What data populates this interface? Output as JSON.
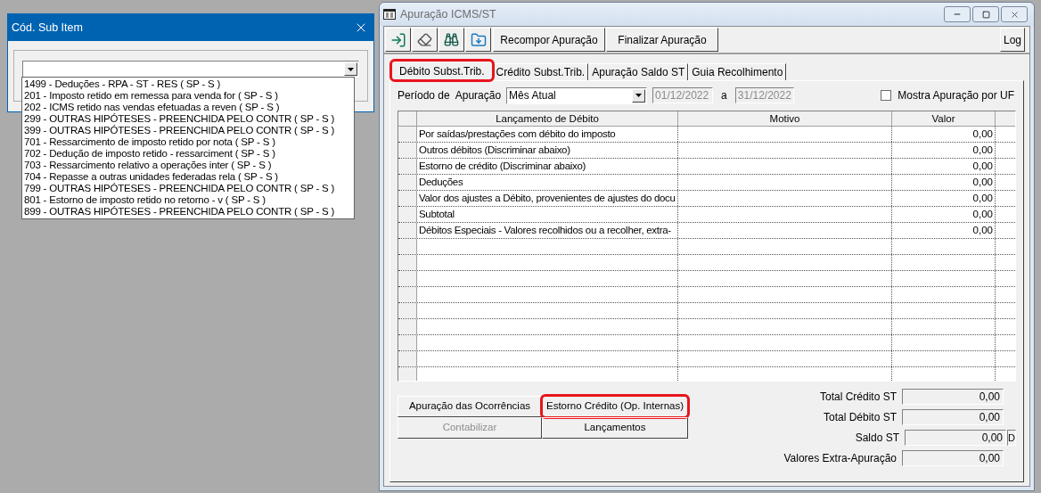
{
  "sub_item_dialog": {
    "title": "Cód. Sub Item",
    "combo": {
      "open": true
    },
    "options": [
      {
        "label": "1499 - Deduções - RPA - ST - RES ( SP - S )"
      },
      {
        "label": "201 - Imposto retido em remessa para venda for ( SP - S )"
      },
      {
        "label": "202 - ICMS retido nas vendas efetuadas a reven ( SP - S )"
      },
      {
        "label": "299 - OUTRAS HIPÓTESES - PREENCHIDA PELO CONTR ( SP - S )"
      },
      {
        "label": "399 - OUTRAS HIPÓTESES - PREENCHIDA PELO CONTR ( SP - S )"
      },
      {
        "label": "701 - Ressarcimento de imposto retido por nota ( SP - S )"
      },
      {
        "label": "702 - Dedução de imposto retido - ressarciment ( SP - S )"
      },
      {
        "label": "703 - Ressarcimento relativo a operações inter ( SP - S )"
      },
      {
        "label": "704 - Repasse a outras unidades federadas rela ( SP - S )"
      },
      {
        "label": "799 - OUTRAS HIPÓTESES - PREENCHIDA PELO CONTR ( SP - S )"
      },
      {
        "label": "801 - Estorno de imposto retido no retorno - v ( SP - S )"
      },
      {
        "label": "899 - OUTRAS HIPÓTESES - PREENCHIDA PELO CONTR ( SP - S )"
      }
    ]
  },
  "main_window": {
    "title": "Apuração ICMS/ST",
    "toolbar": {
      "buttons": [
        "Recompor Apuração",
        "Finalizar Apuração"
      ],
      "log": "Log"
    },
    "tabs": [
      {
        "label": "Débito Subst.Trib.",
        "selected": true,
        "highlighted": true
      },
      {
        "label": "Crédito Subst.Trib.",
        "selected": false,
        "highlighted": false
      },
      {
        "label": "Apuração Saldo ST",
        "selected": false,
        "highlighted": false
      },
      {
        "label": "Guia Recolhimento",
        "selected": false,
        "highlighted": false
      }
    ],
    "period": {
      "label": "Período de  Apuração",
      "value": "Mês Atual",
      "from": "01/12/2022",
      "separator": "a",
      "to": "31/12/2022",
      "by_uf": {
        "label": "Mostra Apuração por UF",
        "checked": false
      }
    },
    "table": {
      "columns": [
        "Lançamento de Débito",
        "Motivo",
        "Valor"
      ],
      "rows": [
        {
          "entry": "Por saídas/prestações com débito do imposto",
          "value": "0,00"
        },
        {
          "entry": "Outros débitos (Discriminar abaixo)",
          "value": "0,00"
        },
        {
          "entry": "Estorno de crédito (Discriminar abaixo)",
          "value": "0,00"
        },
        {
          "entry": "Deduções",
          "value": "0,00"
        },
        {
          "entry": "Valor dos ajustes a Débito, provenientes de ajustes do docu",
          "value": "0,00"
        },
        {
          "entry": "Subtotal",
          "value": "0,00"
        },
        {
          "entry": "Débitos Especiais - Valores recolhidos ou a recolher, extra-",
          "value": "0,00"
        }
      ]
    },
    "actions": [
      {
        "label": "Apuração das Ocorrências",
        "disabled": false,
        "highlighted": false
      },
      {
        "label": "Estorno Crédito (Op. Internas)",
        "disabled": false,
        "highlighted": true
      },
      {
        "label": "Contabilizar",
        "disabled": true,
        "highlighted": false
      },
      {
        "label": "Lançamentos",
        "disabled": false,
        "highlighted": false
      }
    ],
    "totals": [
      {
        "label": "Total Crédito ST",
        "value": "0,00"
      },
      {
        "label": "Total Débito ST",
        "value": "0,00"
      },
      {
        "label": "Saldo ST",
        "value": "0,00",
        "flag": "D"
      },
      {
        "label": "Valores Extra-Apuração",
        "value": "0,00"
      }
    ]
  }
}
